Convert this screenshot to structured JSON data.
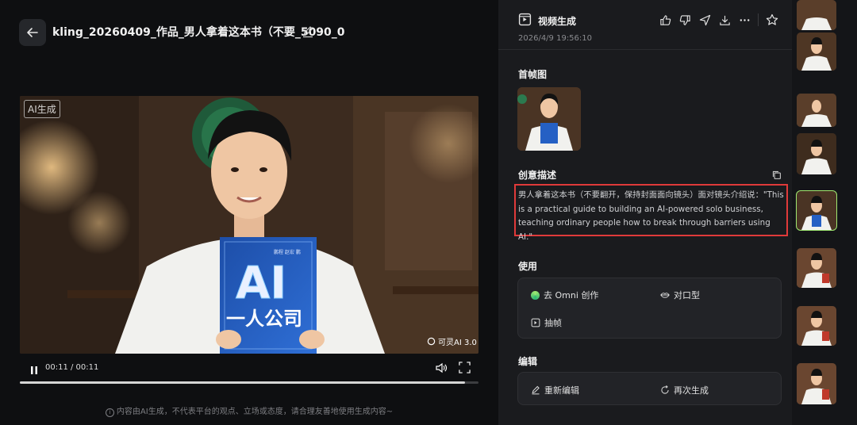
{
  "header": {
    "title": "kling_20260409_作品_男人拿着这本书（不要_5090_0"
  },
  "video": {
    "watermark_ai": "AI生成",
    "watermark_kling": "可灵AI 3.0",
    "book_small_text": "鹏程 赵宏 鹏",
    "book_title_ai": "AI",
    "book_title_cn": "一人公司",
    "time": "00:11 / 00:11",
    "progress": 0.97
  },
  "disclaimer": "内容由AI生成，不代表平台的观点、立场或态度，请合理友善地使用生成内容~",
  "panel": {
    "title": "视频生成",
    "date": "2026/4/9 19:56:10",
    "first_frame_label": "首帧图",
    "prompt_label": "创意描述",
    "prompt": "男人拿着这本书（不要翻开，保持封面面向镜头）面对镜头介绍说：\"This is a practical guide to building an AI-powered solo business, teaching ordinary people how to break through barriers using AI.\"",
    "use_label": "使用",
    "use_items": [
      "去 Omni 创作",
      "对口型",
      "抽帧"
    ],
    "edit_label": "编辑",
    "edit_items": [
      "重新编辑",
      "再次生成"
    ]
  },
  "colors": {
    "accent_green": "#9fe870",
    "highlight_red": "#e03a3a"
  }
}
